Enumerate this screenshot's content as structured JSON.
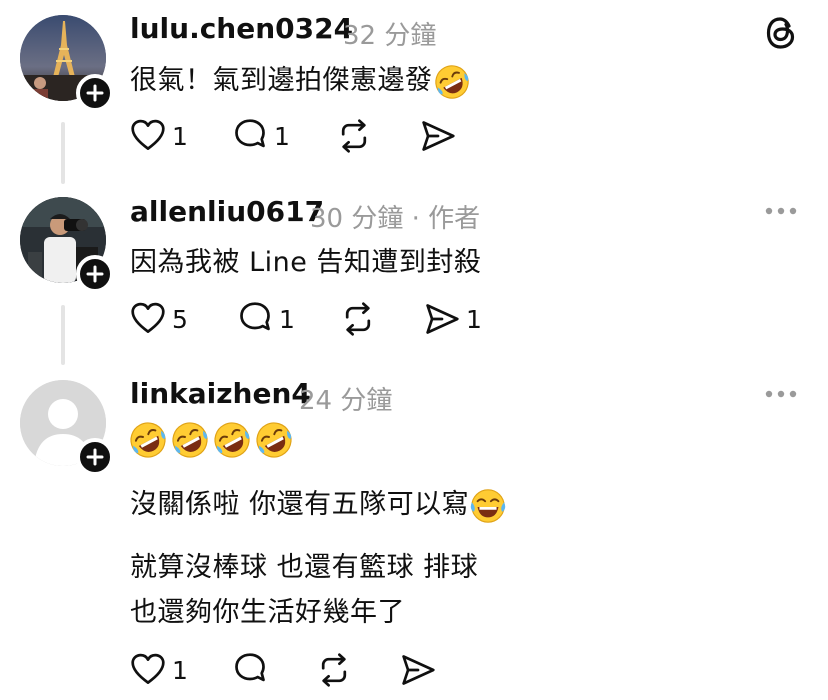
{
  "comments": [
    {
      "username": "lulu.chen0324",
      "time": "32 分鐘",
      "author_tag": "",
      "text": "很氣！氣到邊拍傑憲邊發",
      "likes": "1",
      "replies": "1",
      "reposts": "",
      "shares": ""
    },
    {
      "username": "allenliu0617",
      "time": "30 分鐘",
      "author_tag": "· 作者",
      "text": "因為我被 Line 告知遭到封殺",
      "likes": "5",
      "replies": "1",
      "reposts": "",
      "shares": "1"
    },
    {
      "username": "linkaizhen4",
      "time": "24 分鐘",
      "author_tag": "",
      "line_2": "沒關係啦 你還有五隊可以寫",
      "line_3": "就算沒棒球 也還有籃球 排球",
      "line_4": "也還夠你生活好幾年了",
      "likes": "1",
      "replies": "",
      "reposts": "",
      "shares": ""
    }
  ],
  "icons": {
    "app_logo": "threads-logo-icon",
    "like": "heart-icon",
    "reply": "comment-icon",
    "repost": "repost-icon",
    "share": "send-icon",
    "more": "more-icon",
    "follow": "plus-icon"
  },
  "colors": {
    "text": "#101010",
    "muted": "#9a9a9a",
    "thread_line": "#e4e4e4",
    "emoji_face": "#ffcc33"
  }
}
